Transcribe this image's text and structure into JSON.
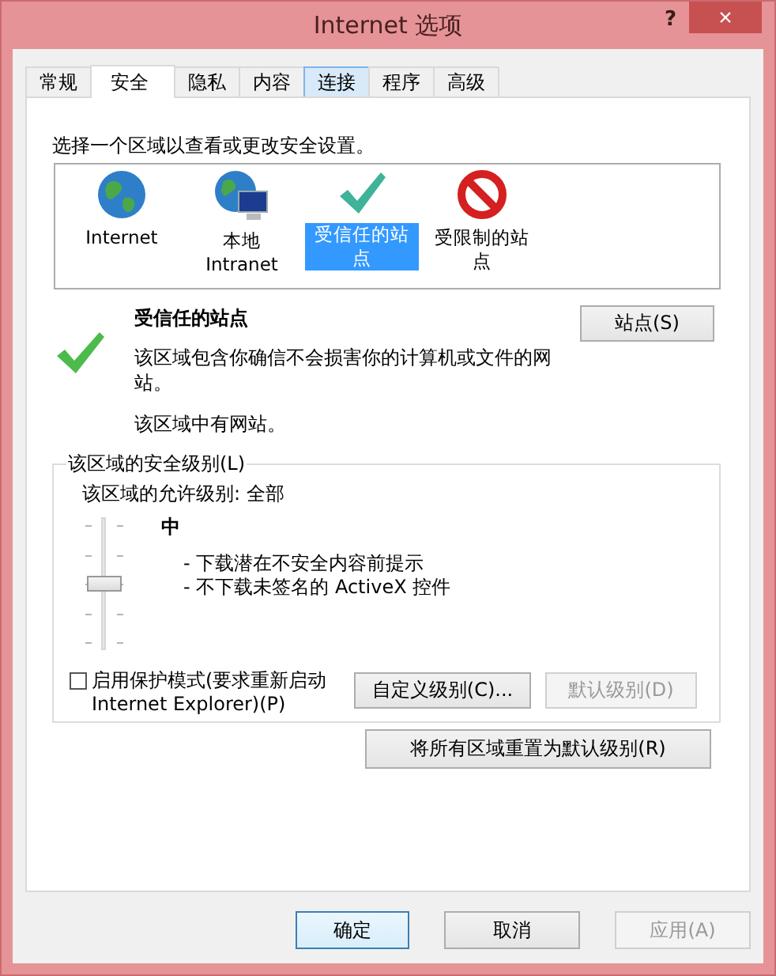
{
  "window": {
    "title": "Internet 选项",
    "help": "?",
    "close": "×"
  },
  "tabs": [
    {
      "label": "常规",
      "selected": false,
      "hover": false
    },
    {
      "label": "安全",
      "selected": true,
      "hover": false
    },
    {
      "label": "隐私",
      "selected": false,
      "hover": false
    },
    {
      "label": "内容",
      "selected": false,
      "hover": false
    },
    {
      "label": "连接",
      "selected": false,
      "hover": true
    },
    {
      "label": "程序",
      "selected": false,
      "hover": false
    },
    {
      "label": "高级",
      "selected": false,
      "hover": false
    }
  ],
  "zone_prompt": "选择一个区域以查看或更改安全设置。",
  "zones": [
    {
      "kind": "globe",
      "label": "Internet",
      "selected": false
    },
    {
      "kind": "intranet",
      "label": "本地 Intranet",
      "selected": false
    },
    {
      "kind": "trusted",
      "label": "受信任的站点",
      "selected": true
    },
    {
      "kind": "restricted",
      "label": "受限制的站点",
      "selected": false
    }
  ],
  "zone_detail": {
    "title": "受信任的站点",
    "description": "该区域包含你确信不会损害你的计算机或文件的网站。",
    "note": "该区域中有网站。",
    "sites_button": "站点(S)"
  },
  "security_level": {
    "legend": "该区域的安全级别(L)",
    "allowed": "该区域的允许级别: 全部",
    "level": 0.5,
    "level_name": "中",
    "details": [
      "- 下载潜在不安全内容前提示",
      "- 不下载未签名的 ActiveX 控件"
    ],
    "protected_mode": {
      "label": "启用保护模式(要求重新启动 Internet Explorer)(P)",
      "checked": false
    },
    "buttons": [
      {
        "label": "自定义级别(C)...",
        "disabled": false
      },
      {
        "label": "默认级别(D)",
        "disabled": true
      }
    ]
  },
  "reset_button": "将所有区域重置为默认级别(R)",
  "footer_buttons": [
    {
      "label": "确定",
      "disabled": false,
      "default": true
    },
    {
      "label": "取消",
      "disabled": false,
      "default": false
    },
    {
      "label": "应用(A)",
      "disabled": true,
      "default": false
    }
  ]
}
